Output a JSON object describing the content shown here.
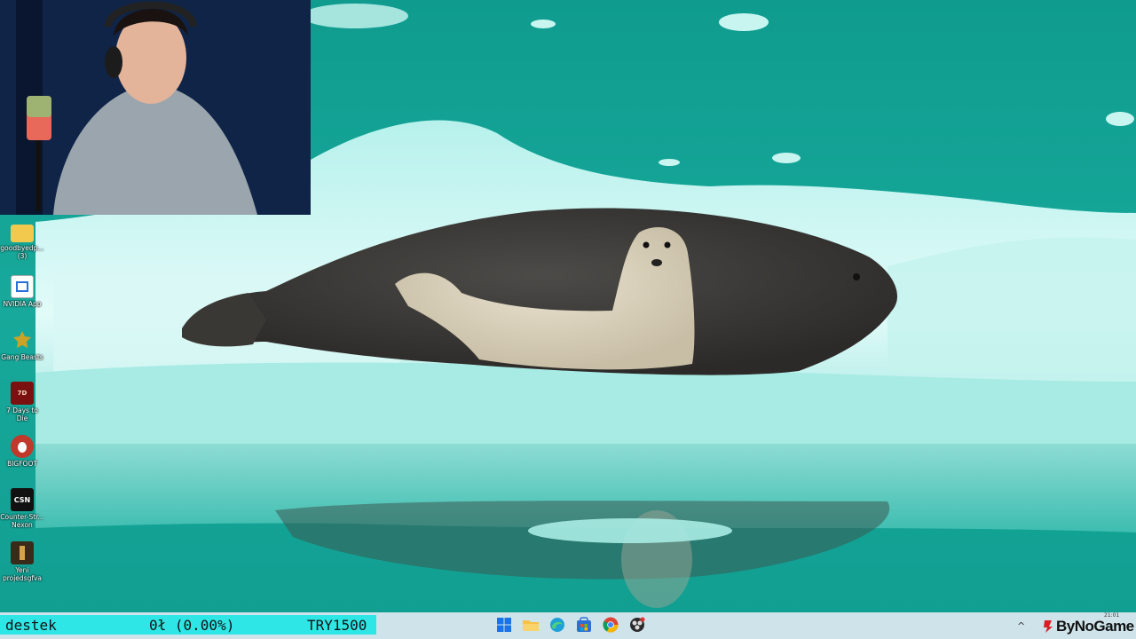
{
  "desktop": {
    "icons": [
      {
        "label": "goodbyedp... (3)",
        "icon": "folder-icon",
        "color": "#f2c94c"
      },
      {
        "label": "NVIDIA App",
        "icon": "nvidia-app-icon",
        "color": "#ffffff"
      },
      {
        "label": "Gang Beasts",
        "icon": "gang-beasts-icon",
        "color": "#c9a227"
      },
      {
        "label": "7 Days to Die",
        "icon": "seven-days-to-die-icon",
        "color": "#7a1010"
      },
      {
        "label": "BIGFOOT",
        "icon": "bigfoot-icon",
        "color": "#c0392b"
      },
      {
        "label": "Counter-Str... Nexon",
        "icon": "counter-strike-nexon-icon",
        "color": "#111111"
      },
      {
        "label": "Yeni projedsgfva",
        "icon": "project-icon",
        "color": "#3a2a1a"
      }
    ]
  },
  "ticker": {
    "name": "destek",
    "amount": "0ł (0.00%)",
    "goal": "TRY1500",
    "bg_color": "#2fe6e6"
  },
  "taskbar": {
    "apps": [
      {
        "name": "windows-start-icon"
      },
      {
        "name": "file-explorer-icon"
      },
      {
        "name": "edge-browser-icon"
      },
      {
        "name": "microsoft-store-icon"
      },
      {
        "name": "chrome-icon"
      },
      {
        "name": "obs-icon"
      }
    ],
    "tray_chevron": "^",
    "clock": "21:01"
  },
  "watermark": {
    "text": "ByNoGame"
  }
}
